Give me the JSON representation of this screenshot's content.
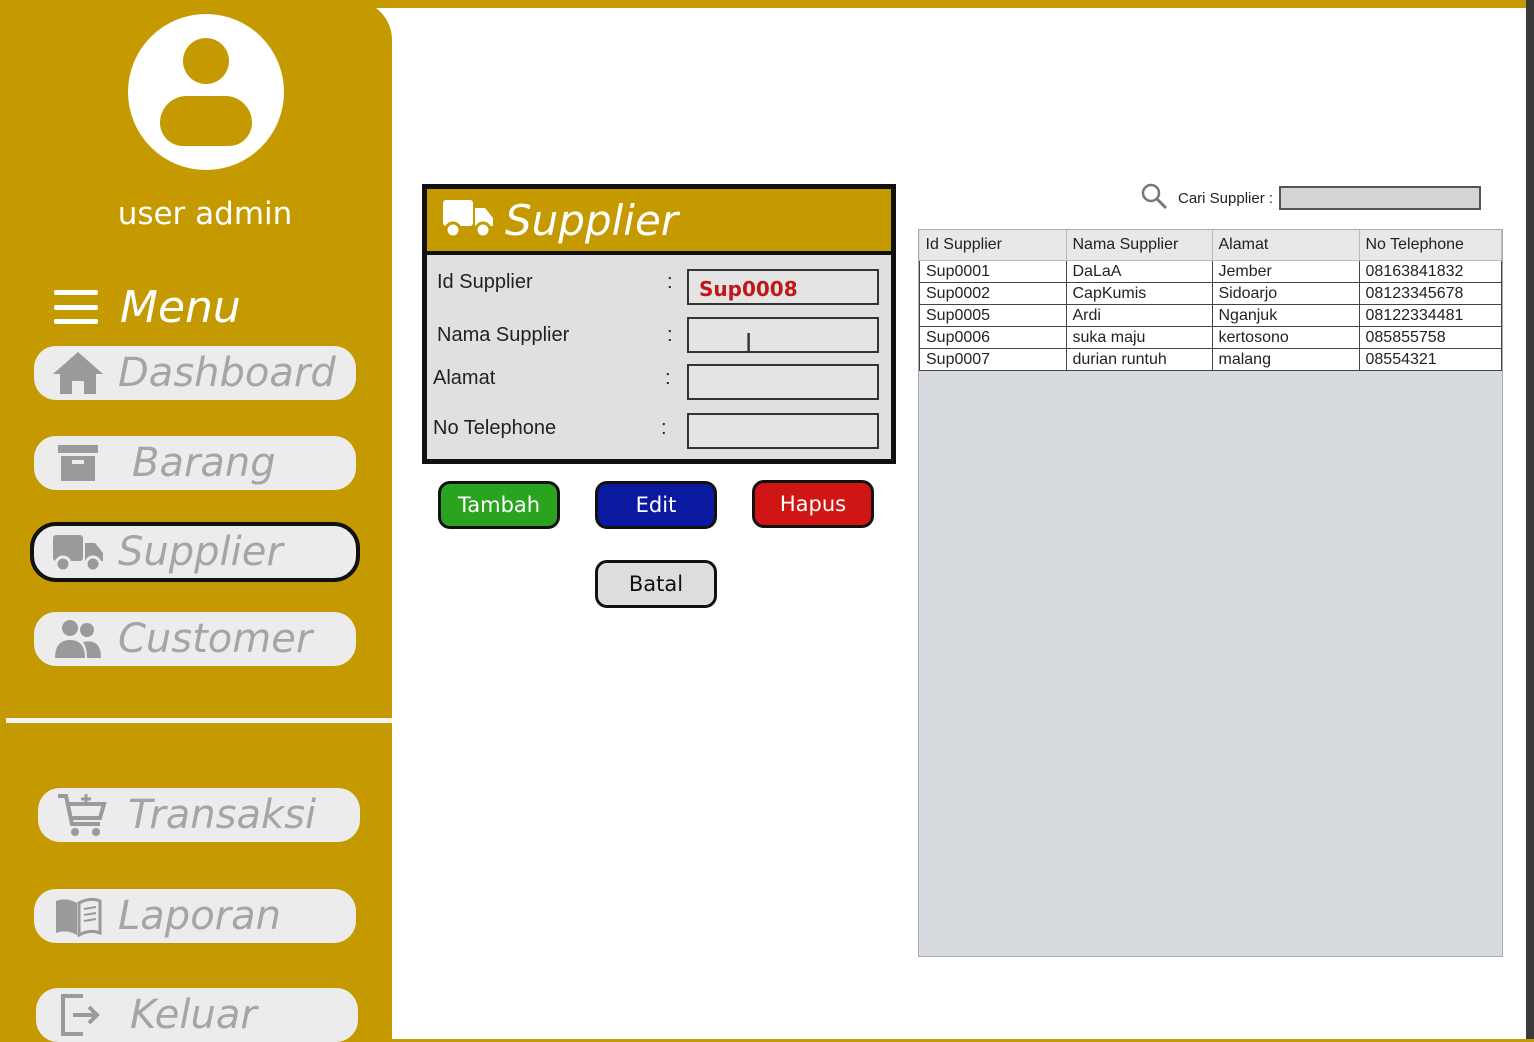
{
  "user": {
    "name": "user admin"
  },
  "menu": {
    "title": "Menu"
  },
  "nav": {
    "dashboard": "Dashboard",
    "barang": "Barang",
    "supplier": "Supplier",
    "customer": "Customer",
    "transaksi": "Transaksi",
    "laporan": "Laporan",
    "keluar": "Keluar"
  },
  "form": {
    "title": "Supplier",
    "id_label": "Id Supplier",
    "id_value": "Sup0008",
    "nama_label": "Nama Supplier",
    "nama_value": "",
    "alamat_label": "Alamat",
    "alamat_value": "",
    "telp_label": "No Telephone",
    "telp_value": "",
    "colon": ":"
  },
  "buttons": {
    "tambah": "Tambah",
    "edit": "Edit",
    "hapus": "Hapus",
    "batal": "Batal"
  },
  "search": {
    "label": "Cari Supplier :",
    "value": ""
  },
  "table": {
    "headers": [
      "Id Supplier",
      "Nama Supplier",
      "Alamat",
      "No Telephone"
    ],
    "rows": [
      [
        "Sup0001",
        "DaLaA",
        "Jember",
        "08163841832"
      ],
      [
        "Sup0002",
        "CapKumis",
        "Sidoarjo",
        "08123345678"
      ],
      [
        "Sup0005",
        "Ardi",
        "Nganjuk",
        "08122334481"
      ],
      [
        "Sup0006",
        "suka maju",
        "kertosono",
        "085855758"
      ],
      [
        "Sup0007",
        "durian runtuh",
        "malang",
        "08554321"
      ]
    ]
  },
  "colors": {
    "accent": "#c49a00",
    "tambah": "#2aa41e",
    "edit": "#0a1aa0",
    "hapus": "#d01515",
    "batal": "#dddddd"
  }
}
